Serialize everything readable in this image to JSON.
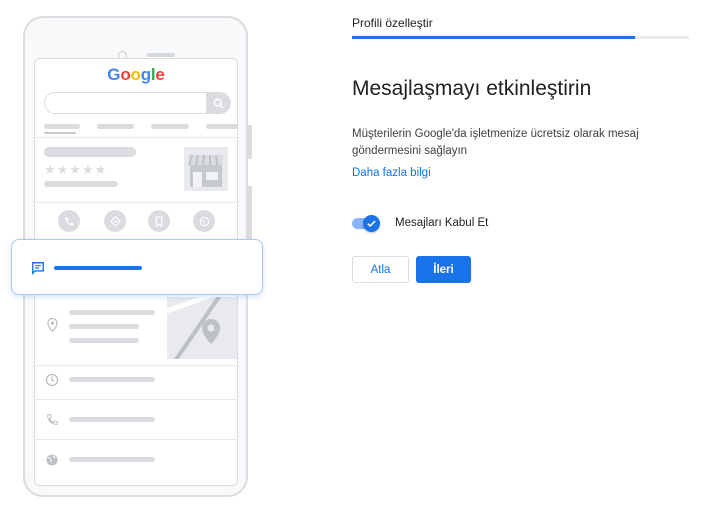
{
  "wizard": {
    "step_title": "Profili özelleştir",
    "progress_percent": 84,
    "heading": "Mesajlaşmayı etkinleştirin",
    "description": "Müşterilerin Google'da işletmenize ücretsiz olarak mesaj göndermesini sağlayın",
    "learn_more": "Daha fazla bilgi",
    "toggle": {
      "label": "Mesajları Kabul Et",
      "checked": true
    },
    "buttons": {
      "skip": "Atla",
      "next": "İleri"
    }
  },
  "illustration": {
    "logo": "Google",
    "icons": [
      "search-icon",
      "storefront-icon",
      "phone-icon",
      "directions-icon",
      "bookmark-icon",
      "website-icon",
      "chat-icon",
      "location-pin-icon",
      "clock-icon",
      "phone-icon",
      "globe-icon"
    ]
  },
  "colors": {
    "accent": "#1a73e8",
    "placeholder": "#dadce0",
    "border": "#dadce0"
  }
}
